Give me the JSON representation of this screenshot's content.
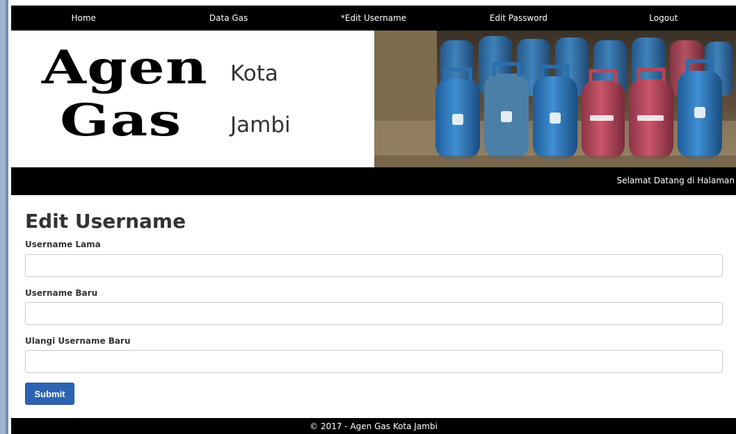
{
  "nav": {
    "items": [
      {
        "label": "Home"
      },
      {
        "label": "Data Gas"
      },
      {
        "label": "*Edit Username"
      },
      {
        "label": "Edit Password"
      },
      {
        "label": "Logout"
      }
    ]
  },
  "header": {
    "logo_line1": "Agen",
    "logo_line2": "Gas",
    "city_line1": "Kota",
    "city_line2": "Jambi"
  },
  "welcome": {
    "text": "Selamat Datang di Halaman"
  },
  "form": {
    "title": "Edit Username",
    "fields": [
      {
        "label": "Username Lama",
        "value": ""
      },
      {
        "label": "Username Baru",
        "value": ""
      },
      {
        "label": "Ulangi Username Baru",
        "value": ""
      }
    ],
    "submit_label": "Submit"
  },
  "footer": {
    "text": "© 2017 - Agen Gas Kota Jambi"
  },
  "colors": {
    "nav_bg": "#000000",
    "submit_bg": "#2d63b2",
    "left_accent": "#9fb4cf"
  }
}
